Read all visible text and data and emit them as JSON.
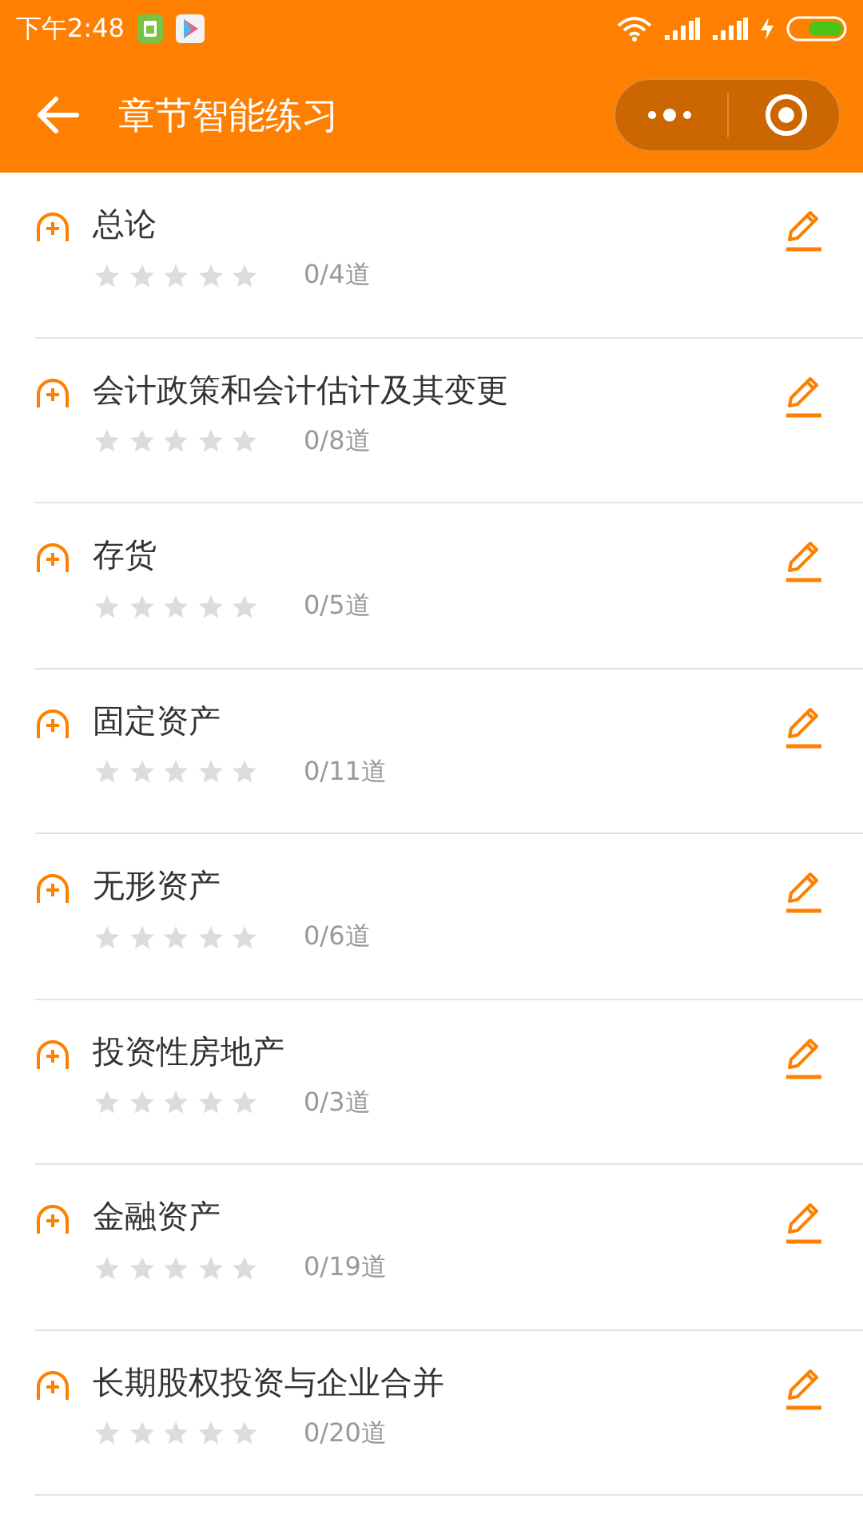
{
  "status_bar": {
    "time": "下午2:48"
  },
  "nav_bar": {
    "title": "章节智能练习"
  },
  "chapters": [
    {
      "title": "总论",
      "stars": 0,
      "count": "0/4道"
    },
    {
      "title": "会计政策和会计估计及其变更",
      "stars": 0,
      "count": "0/8道"
    },
    {
      "title": "存货",
      "stars": 0,
      "count": "0/5道"
    },
    {
      "title": "固定资产",
      "stars": 0,
      "count": "0/11道"
    },
    {
      "title": "无形资产",
      "stars": 0,
      "count": "0/6道"
    },
    {
      "title": "投资性房地产",
      "stars": 0,
      "count": "0/3道"
    },
    {
      "title": "金融资产",
      "stars": 0,
      "count": "0/19道"
    },
    {
      "title": "长期股权投资与企业合并",
      "stars": 0,
      "count": "0/20道"
    }
  ]
}
